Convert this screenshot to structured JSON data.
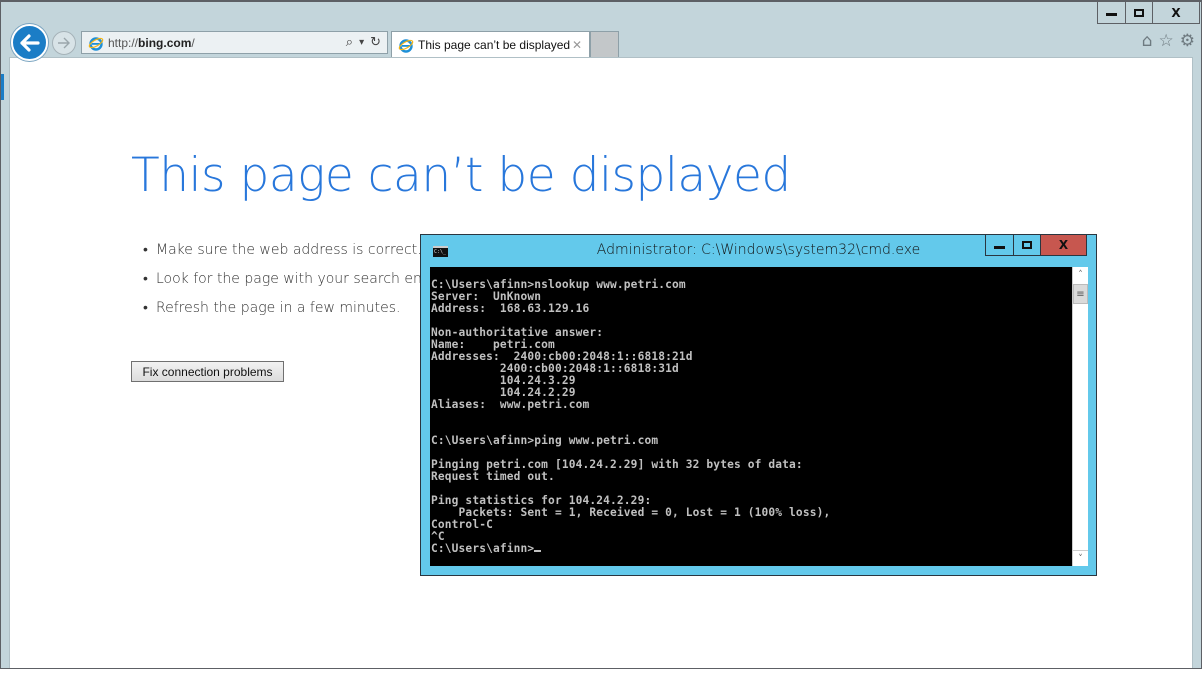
{
  "browser": {
    "address_prefix": "http://",
    "address_domain": "bing.com",
    "address_suffix": "/",
    "tab_title": "This page can’t be displayed",
    "tab_close": "✕",
    "icons": {
      "back": "back-arrow-icon",
      "forward": "forward-arrow-icon",
      "search": "⌕",
      "dropdown": "▾",
      "refresh": "↻",
      "home": "⌂",
      "favorites": "☆",
      "tools": "⚙"
    },
    "window_controls": {
      "close": "X"
    }
  },
  "page": {
    "title": "This page can’t be displayed",
    "tips": [
      "Make sure the web address is correct.",
      "Look for the page with your search engine.",
      "Refresh the page in a few minutes."
    ],
    "fix_button": "Fix connection problems",
    "accent_color": "#2877db"
  },
  "cmd": {
    "title": "Administrator: C:\\Windows\\system32\\cmd.exe",
    "icon_text": "C:\\_",
    "close_label": "X",
    "scroll_up": "˄",
    "scroll_down": "˅",
    "scroll_thumb": "≡",
    "output": "C:\\Users\\afinn>nslookup www.petri.com\nServer:  UnKnown\nAddress:  168.63.129.16\n\nNon-authoritative answer:\nName:    petri.com\nAddresses:  2400:cb00:2048:1::6818:21d\n          2400:cb00:2048:1::6818:31d\n          104.24.3.29\n          104.24.2.29\nAliases:  www.petri.com\n\n\nC:\\Users\\afinn>ping www.petri.com\n\nPinging petri.com [104.24.2.29] with 32 bytes of data:\nRequest timed out.\n\nPing statistics for 104.24.2.29:\n    Packets: Sent = 1, Received = 0, Lost = 1 (100% loss),\nControl-C\n^C\nC:\\Users\\afinn>",
    "colors": {
      "frame": "#63c9eb",
      "close": "#c7574f",
      "console_bg": "#000000",
      "console_fg": "#c0c0c0"
    }
  }
}
